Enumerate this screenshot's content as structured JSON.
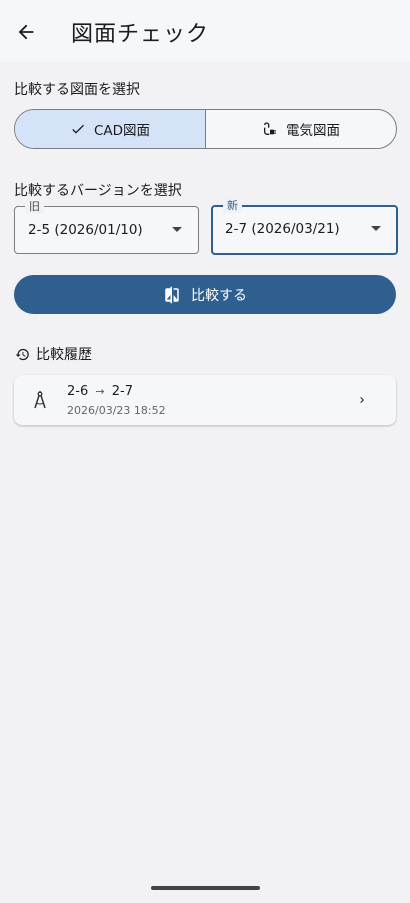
{
  "app_bar": {
    "title": "図面チェック"
  },
  "drawing_section": {
    "label": "比較する図面を選択",
    "options": [
      {
        "label": "CAD図面",
        "selected": true
      },
      {
        "label": "電気図面",
        "selected": false
      }
    ]
  },
  "version_section": {
    "label": "比較するバージョンを選択",
    "old": {
      "label": "旧",
      "value": "2-5 (2026/01/10)"
    },
    "new": {
      "label": "新",
      "value": "2-7 (2026/03/21)"
    }
  },
  "compare_button": {
    "label": "比較する"
  },
  "history": {
    "title": "比較履歴",
    "items": [
      {
        "from": "2-6",
        "arrow": "→",
        "to": "2-7",
        "date": "2026/03/23 18:52"
      }
    ]
  },
  "colors": {
    "primary": "#2e5f8e",
    "segment_selected": "#d5e3f8",
    "background": "#f2f2f4"
  }
}
